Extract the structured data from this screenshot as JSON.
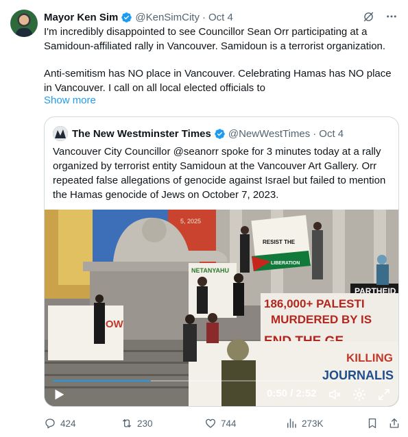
{
  "tweet": {
    "author_name": "Mayor Ken Sim",
    "author_handle": "@KenSimCity",
    "separator": "·",
    "date": "Oct 4",
    "text_para1": "I'm incredibly disappointed to see Councillor Sean Orr participating at a Samidoun-affiliated rally in Vancouver. Samidoun is a terrorist organization.",
    "text_para2": "Anti-semitism has NO place in Vancouver. Celebrating Hamas has NO place in Vancouver. I call on all local elected officials to",
    "show_more": "Show more",
    "icons": {
      "verified": "verified-badge-icon",
      "grok": "grok-icon",
      "more": "more-icon"
    },
    "colors": {
      "accent": "#1d9bf0",
      "text": "#0f1419",
      "muted": "#536471",
      "border": "#cfd9de"
    }
  },
  "quote": {
    "author_name": "The New Westminster Times",
    "author_handle": "@NewWestTimes",
    "separator": "·",
    "date": "Oct 4",
    "text": "Vancouver City Councillor @seanorr spoke for 3 minutes today at a rally organized by terrorist entity Samidoun at the Vancouver Art Gallery. Orr repeated false allegations of genocide against Israel but failed to mention the Hamas genocide of Jews on October 7, 2023.",
    "video": {
      "time_display": "0:50 / 2:52",
      "progress_fraction": 0.29,
      "banner_text_1": "186,000+ PALESTI",
      "banner_text_2": "MURDERED BY IS",
      "banner_text_3": "END THE GE",
      "sign_resist": "RESIST THE",
      "sign_resist_2": "LIBERATION",
      "sign_now": "NOW",
      "sign_apartheid": "PARTHEID",
      "sign_journalists": "JOURNALIS",
      "sign_killing": "KILLING",
      "sign_date": "5, 2025",
      "sign_left": "NETANYAHU",
      "icons": {
        "play": "play-icon",
        "mute": "mute-icon",
        "settings": "settings-icon",
        "fullscreen": "fullscreen-icon"
      }
    }
  },
  "actions": {
    "replies": "424",
    "retweets": "230",
    "likes": "744",
    "views": "273K",
    "icons": {
      "reply": "reply-icon",
      "retweet": "retweet-icon",
      "like": "heart-icon",
      "views": "views-icon",
      "bookmark": "bookmark-icon",
      "share": "share-icon"
    }
  }
}
